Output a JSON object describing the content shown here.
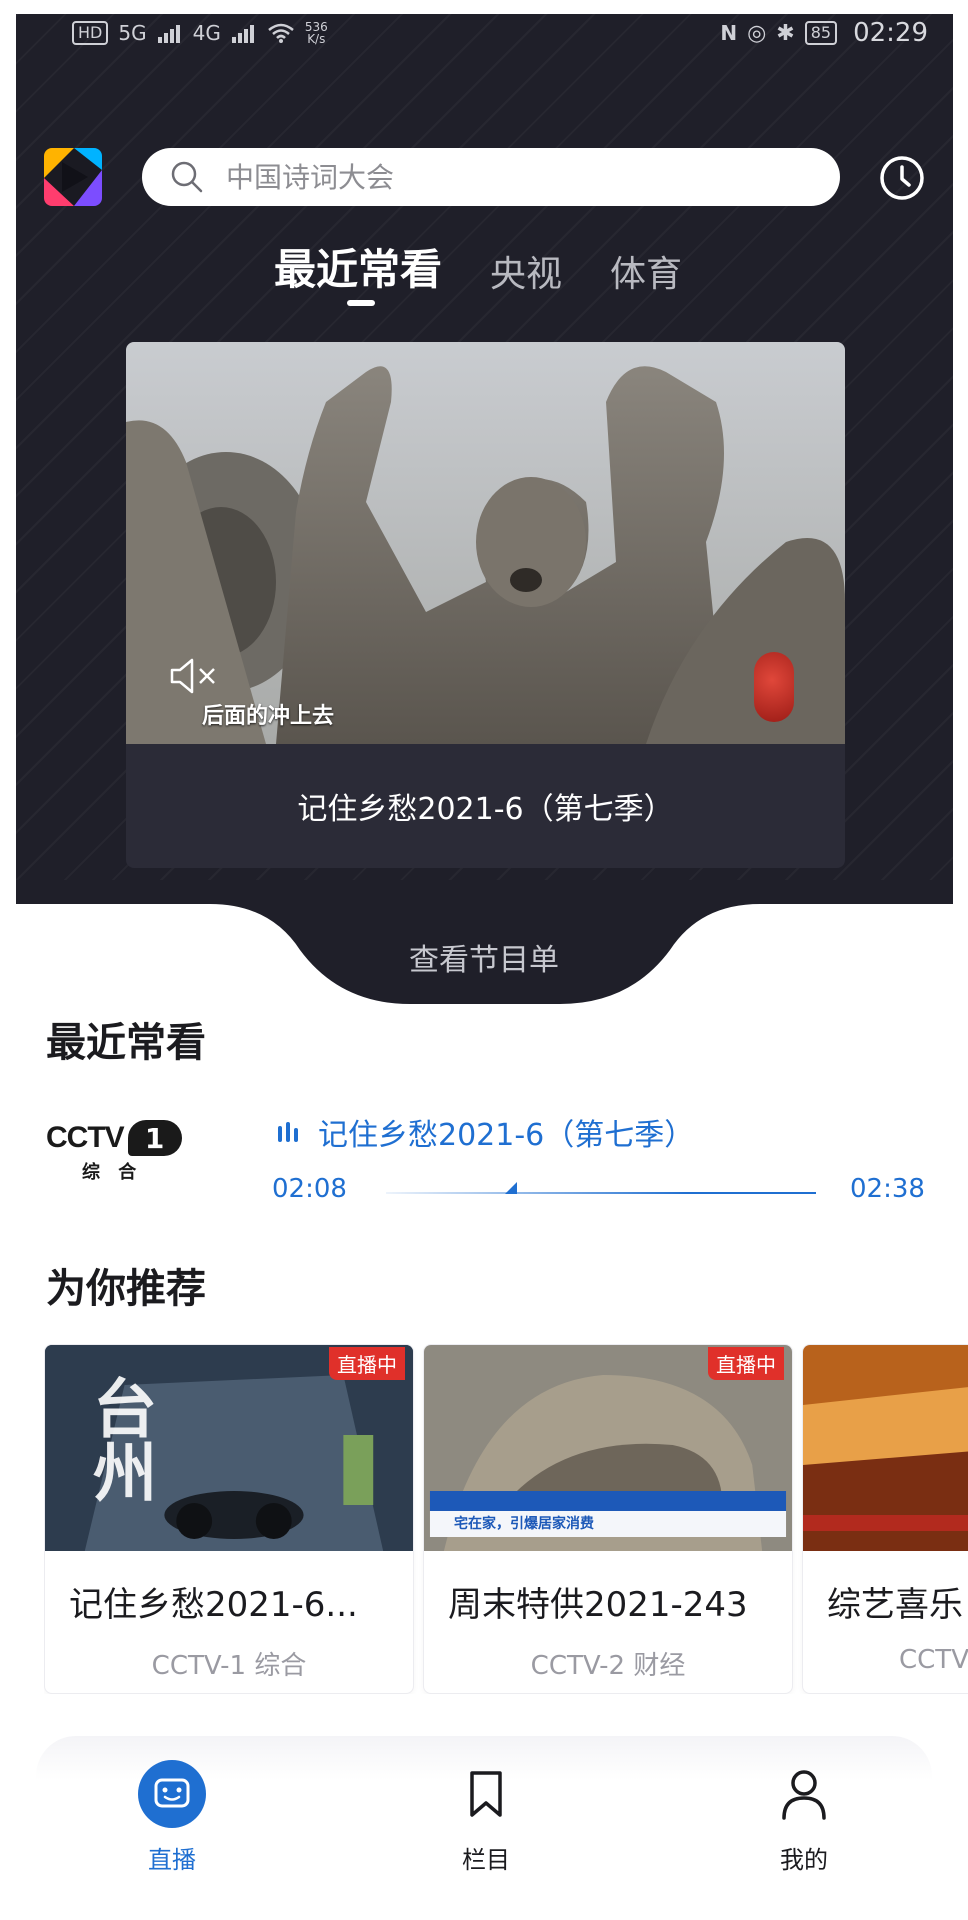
{
  "status_bar": {
    "left_labels": [
      "HD",
      "5G",
      "4G"
    ],
    "net_speed_value": "536",
    "net_speed_unit": "K/s",
    "battery": "85",
    "time": "02:29"
  },
  "search": {
    "placeholder": "中国诗词大会"
  },
  "tabs": [
    {
      "label": "最近常看",
      "active": true
    },
    {
      "label": "央视",
      "active": false
    },
    {
      "label": "体育",
      "active": false
    }
  ],
  "featured": {
    "caption": "后面的冲上去",
    "title": "记住乡愁2021-6（第七季）"
  },
  "guide_label": "查看节目单",
  "recent_section": {
    "title": "最近常看",
    "channel_logo_text": "CCTV",
    "channel_number": "1",
    "channel_sub": "综 合",
    "program": "记住乡愁2021-6（第七季）",
    "time_start": "02:08",
    "time_end": "02:38",
    "progress": 0.3
  },
  "recommend_section": {
    "title": "为你推荐",
    "cards": [
      {
        "title": "记住乡愁2021-6...",
        "channel": "CCTV-1 综合",
        "badge": "直播中",
        "thumb_text": "台州"
      },
      {
        "title": "周末特供2021-243",
        "channel": "CCTV-2 财经",
        "badge": "直播中",
        "thumb_text": "宅在家，引爆居家消费"
      },
      {
        "title": "综艺喜乐",
        "channel": "CCTV",
        "badge": "",
        "thumb_text": ""
      }
    ]
  },
  "bottom_nav": [
    {
      "label": "直播",
      "icon": "tv-face-icon",
      "active": true
    },
    {
      "label": "栏目",
      "icon": "bookmark-icon",
      "active": false
    },
    {
      "label": "我的",
      "icon": "person-icon",
      "active": false
    }
  ],
  "colors": {
    "accent": "#1f6fd1",
    "dark_bg": "#1f1f29",
    "live_badge": "#e0302a"
  }
}
